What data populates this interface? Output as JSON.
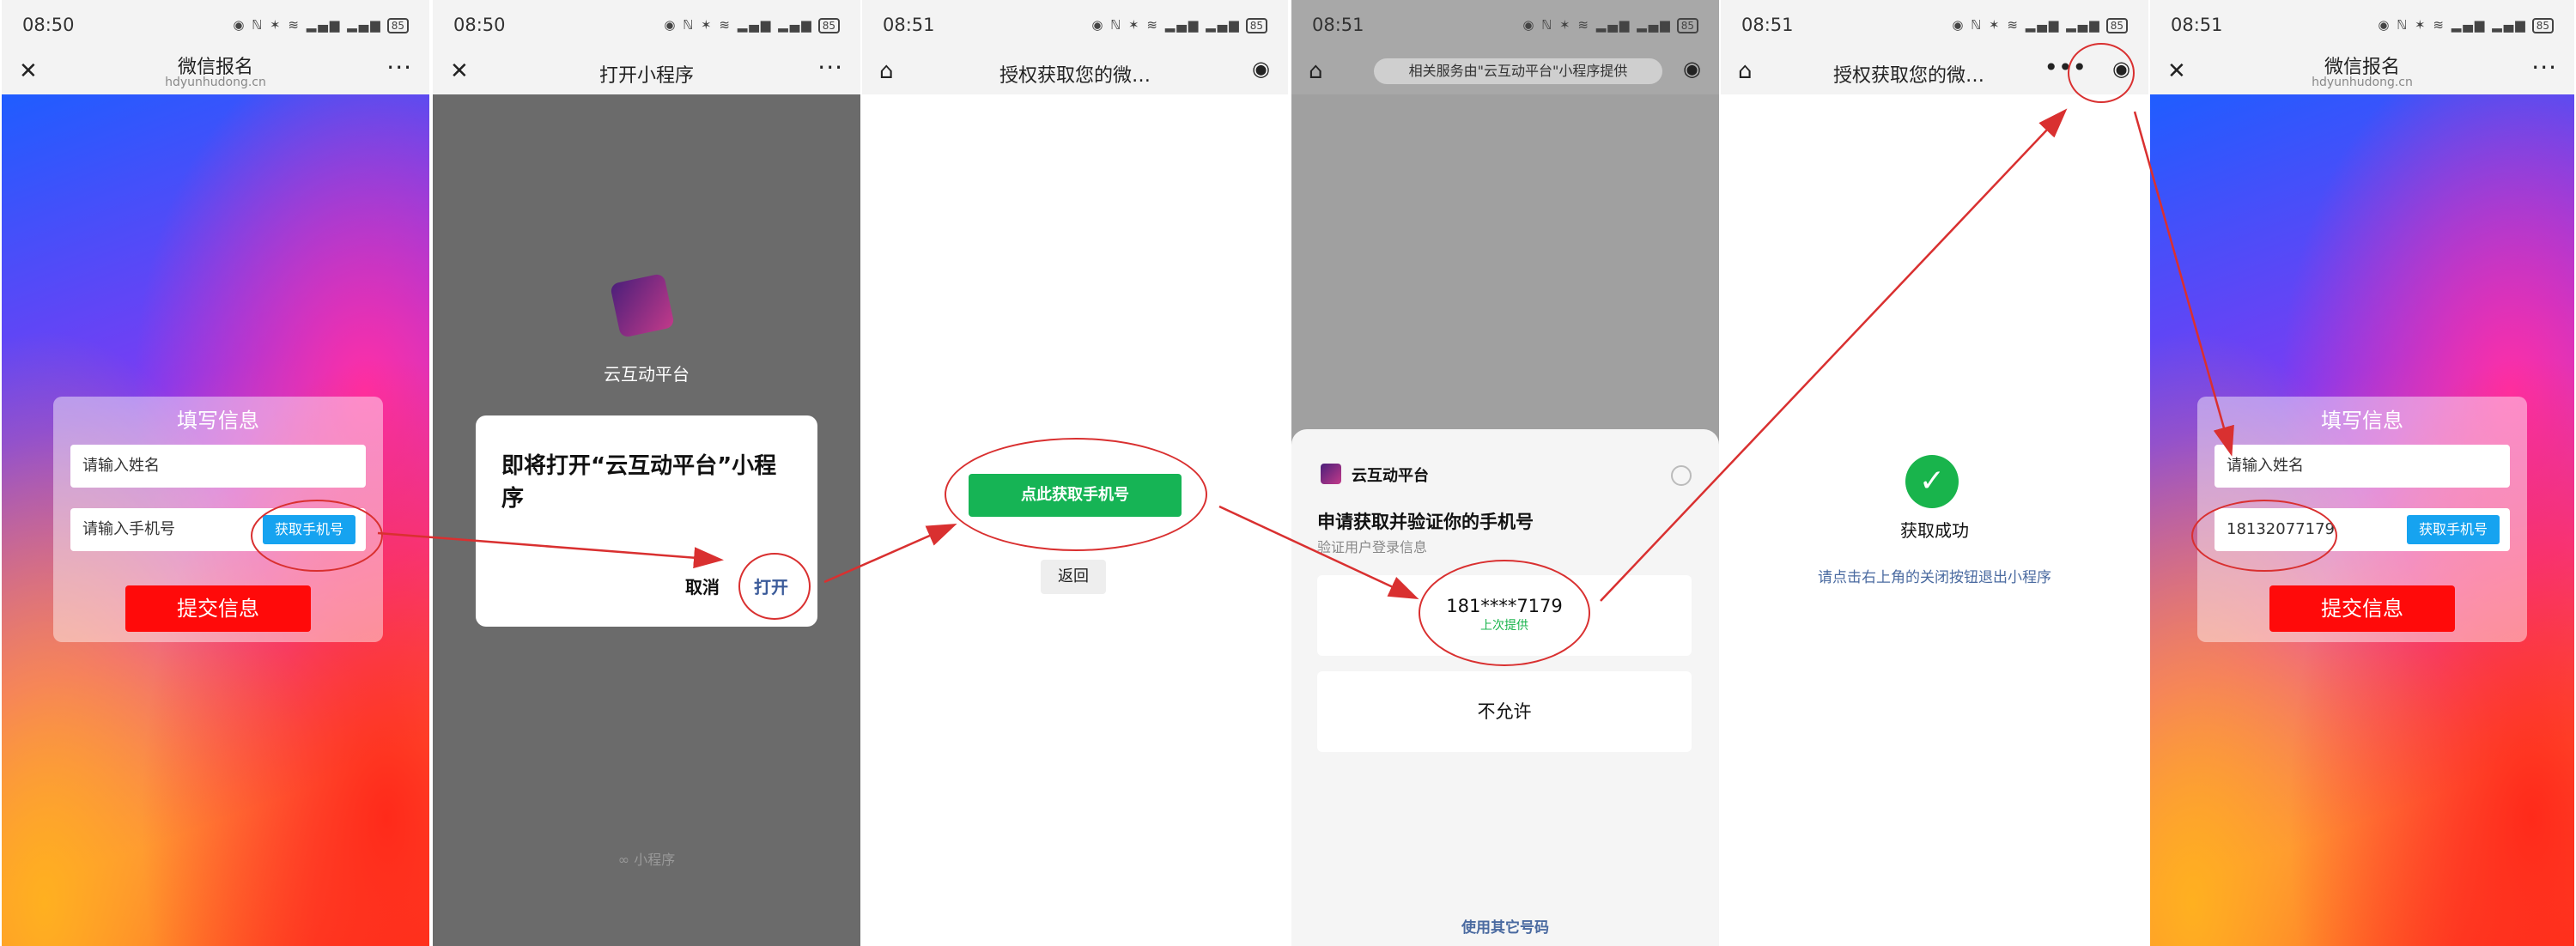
{
  "screens": [
    {
      "time": "08:50",
      "nav": {
        "title": "微信报名",
        "subtitle": "hdyunhudong.cn",
        "left_icon": "close-icon",
        "right_icon": "more-icon"
      },
      "form": {
        "heading": "填写信息",
        "name_placeholder": "请输入姓名",
        "phone_placeholder": "请输入手机号",
        "get_phone_label": "获取手机号",
        "submit_label": "提交信息"
      }
    },
    {
      "time": "08:50",
      "nav": {
        "title": "打开小程序",
        "left_icon": "close-icon",
        "right_icon": "more-icon"
      },
      "app_name": "云互动平台",
      "dialog": {
        "message": "即将打开“云互动平台”小程序",
        "cancel_label": "取消",
        "open_label": "打开"
      },
      "footer": "小程序"
    },
    {
      "time": "08:51",
      "nav": {
        "title": "授权获取您的微…",
        "left_icon": "home-icon",
        "right_icon": "target-icon"
      },
      "primary_label": "点此获取手机号",
      "back_label": "返回"
    },
    {
      "time": "08:51",
      "nav": {
        "title": "相关服务由\"云互动平台\"小程序提供",
        "left_icon": "home-icon",
        "right_icon": "target-icon"
      },
      "sheet": {
        "app_name": "云互动平台",
        "title": "申请获取并验证你的手机号",
        "subtitle": "验证用户登录信息",
        "phone": "181****7179",
        "phone_hint": "上次提供",
        "deny_label": "不允许",
        "other_label": "使用其它号码"
      }
    },
    {
      "time": "08:51",
      "nav": {
        "title": "授权获取您的微…",
        "left_icon": "home-icon",
        "right_icon": "target-icon"
      },
      "success_title": "获取成功",
      "success_hint": "请点击右上角的关闭按钮退出小程序"
    },
    {
      "time": "08:51",
      "nav": {
        "title": "微信报名",
        "subtitle": "hdyunhudong.cn",
        "left_icon": "close-icon",
        "right_icon": "more-icon"
      },
      "form": {
        "heading": "填写信息",
        "name_placeholder": "请输入姓名",
        "phone_value": "18132077179",
        "get_phone_label": "获取手机号",
        "submit_label": "提交信息"
      }
    }
  ],
  "status_battery": "85",
  "annotation_color": "#d93030",
  "accent_green": "#19b44c",
  "accent_blue": "#16a3f0",
  "submit_red": "#ff0a0a"
}
